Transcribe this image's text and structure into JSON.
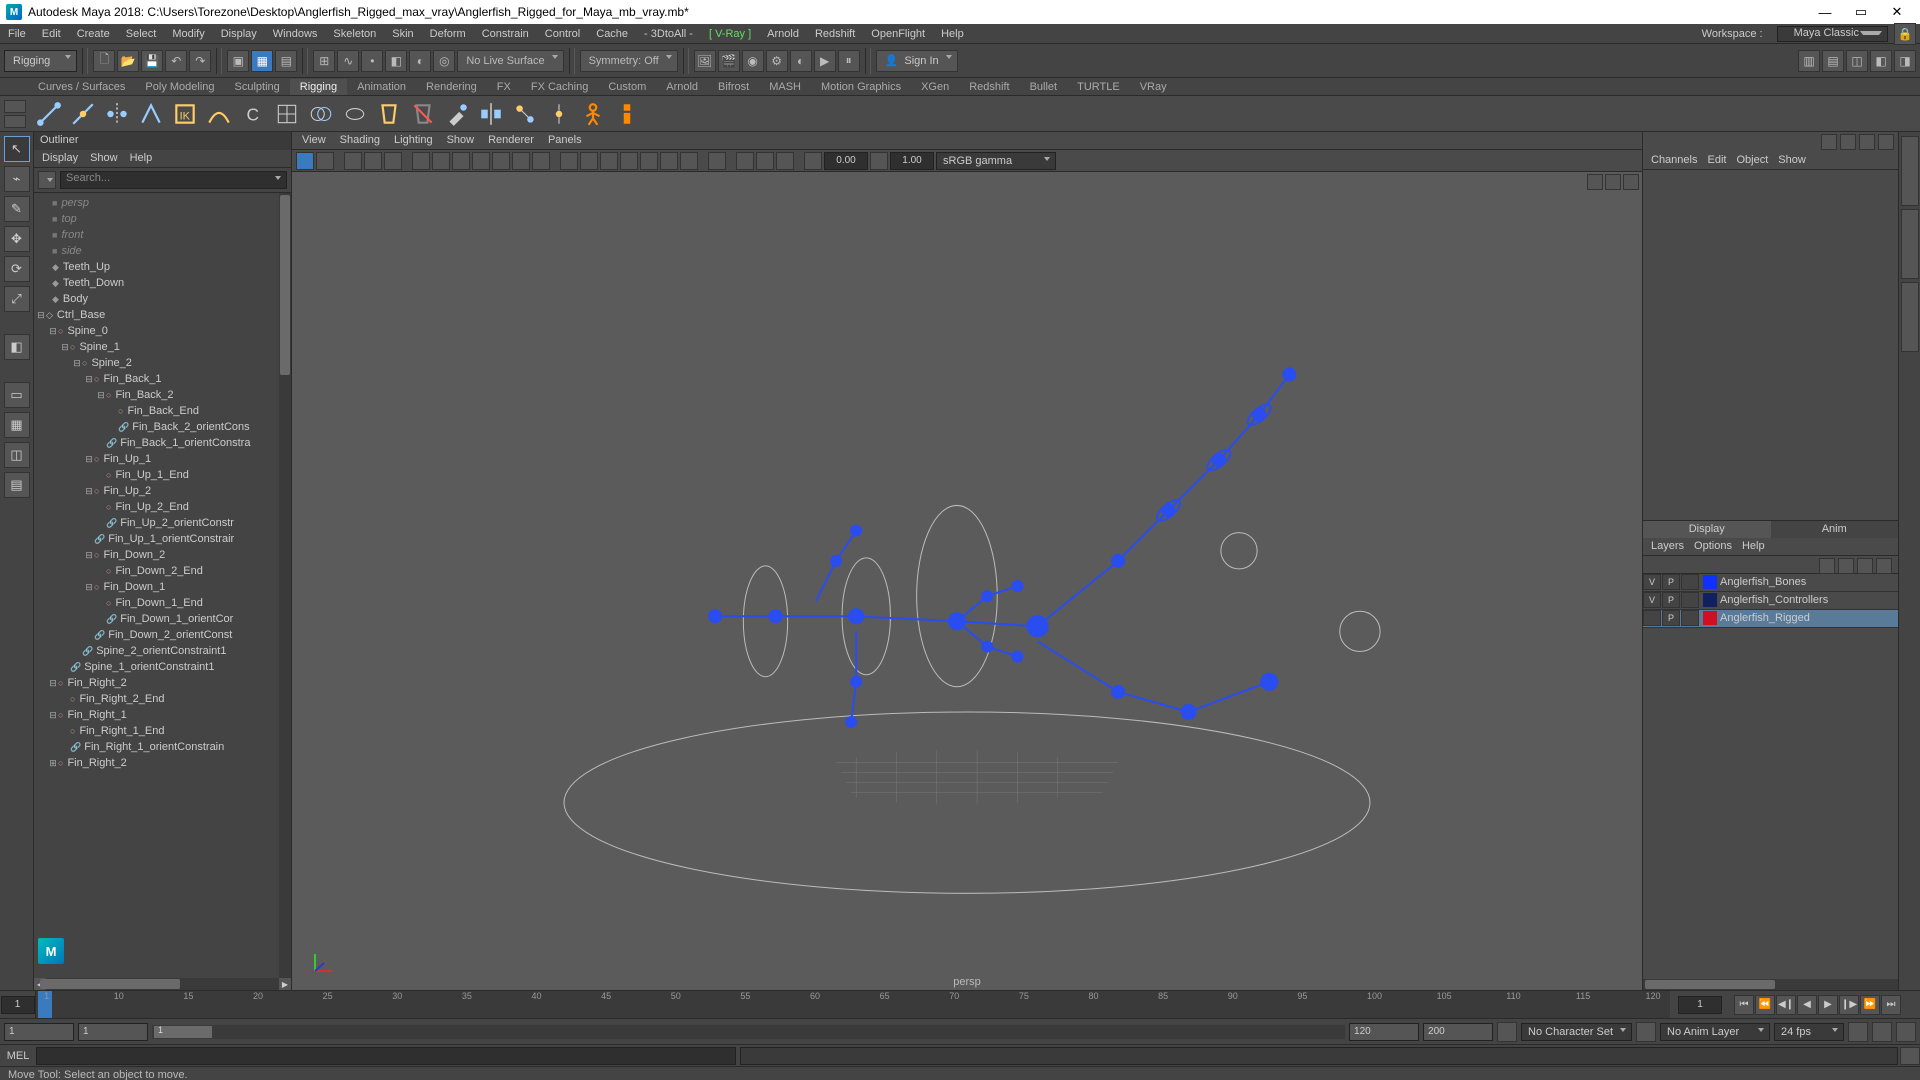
{
  "title": "Autodesk Maya 2018: C:\\Users\\Torezone\\Desktop\\Anglerfish_Rigged_max_vray\\Anglerfish_Rigged_for_Maya_mb_vray.mb*",
  "workspace": {
    "label": "Workspace :",
    "value": "Maya Classic"
  },
  "mainmenu": [
    "File",
    "Edit",
    "Create",
    "Select",
    "Modify",
    "Display",
    "Windows",
    "Skeleton",
    "Skin",
    "Deform",
    "Constrain",
    "Control",
    "Cache",
    "- 3DtoAll -",
    "[ V-Ray ]",
    "Arnold",
    "Redshift",
    "OpenFlight",
    "Help"
  ],
  "menuset": "Rigging",
  "nolive": "No Live Surface",
  "symmetry": "Symmetry: Off",
  "signin": "Sign In",
  "shelf_tabs": [
    "Curves / Surfaces",
    "Poly Modeling",
    "Sculpting",
    "Rigging",
    "Animation",
    "Rendering",
    "FX",
    "FX Caching",
    "Custom",
    "Arnold",
    "Bifrost",
    "MASH",
    "Motion Graphics",
    "XGen",
    "Redshift",
    "Bullet",
    "TURTLE",
    "VRay"
  ],
  "shelf_active": "Rigging",
  "outliner": {
    "title": "Outliner",
    "menu": [
      "Display",
      "Show",
      "Help"
    ],
    "search_placeholder": "Search...",
    "cams": [
      "persp",
      "top",
      "front",
      "side"
    ],
    "meshes": [
      "Teeth_Up",
      "Teeth_Down",
      "Body"
    ],
    "ctrl": "Ctrl_Base",
    "tree": [
      "Spine_0",
      "Spine_1",
      "Spine_2",
      "Fin_Back_1",
      "Fin_Back_2",
      "Fin_Back_End",
      "Fin_Back_2_orientCons",
      "Fin_Back_1_orientConstra",
      "Fin_Up_1",
      "Fin_Up_1_End",
      "Fin_Up_2",
      "Fin_Up_2_End",
      "Fin_Up_2_orientConstr",
      "Fin_Up_1_orientConstrair",
      "Fin_Down_2",
      "Fin_Down_2_End",
      "Fin_Down_1",
      "Fin_Down_1_End",
      "Fin_Down_1_orientCor",
      "Fin_Down_2_orientConst",
      "Spine_2_orientConstraint1",
      "Spine_1_orientConstraint1",
      "Fin_Right_2",
      "Fin_Right_2_End",
      "Fin_Right_1",
      "Fin_Right_1_End",
      "Fin_Right_1_orientConstrain",
      "Fin_Right_2"
    ]
  },
  "viewport": {
    "menu": [
      "View",
      "Shading",
      "Lighting",
      "Show",
      "Renderer",
      "Panels"
    ],
    "exposure": "0.00",
    "gamma": "1.00",
    "colorspace": "sRGB gamma",
    "camera": "persp"
  },
  "channelbox": {
    "menu": [
      "Channels",
      "Edit",
      "Object",
      "Show"
    ],
    "tabs": [
      "Display",
      "Anim"
    ],
    "layermenu": [
      "Layers",
      "Options",
      "Help"
    ],
    "layers": [
      {
        "v": "V",
        "p": "P",
        "color": "#1030ff",
        "name": "Anglerfish_Bones",
        "sel": false
      },
      {
        "v": "V",
        "p": "P",
        "color": "#102060",
        "name": "Anglerfish_Controllers",
        "sel": false
      },
      {
        "v": "",
        "p": "P",
        "color": "#d01020",
        "name": "Anglerfish_Rigged",
        "sel": true
      }
    ]
  },
  "timeslider": {
    "current": "1",
    "end_field": "1",
    "ticks": [
      "1",
      "10",
      "15",
      "20",
      "25",
      "30",
      "35",
      "40",
      "45",
      "50",
      "55",
      "60",
      "65",
      "70",
      "75",
      "80",
      "85",
      "90",
      "95",
      "100",
      "105",
      "110",
      "115",
      "120"
    ]
  },
  "rangeslider": {
    "start": "1",
    "in": "1",
    "rangebar_start": "1",
    "out": "120",
    "end": "200",
    "charset": "No Character Set",
    "animlayer": "No Anim Layer",
    "fps": "24 fps"
  },
  "cmd": {
    "lang": "MEL"
  },
  "helpline": "Move Tool: Select an object to move."
}
